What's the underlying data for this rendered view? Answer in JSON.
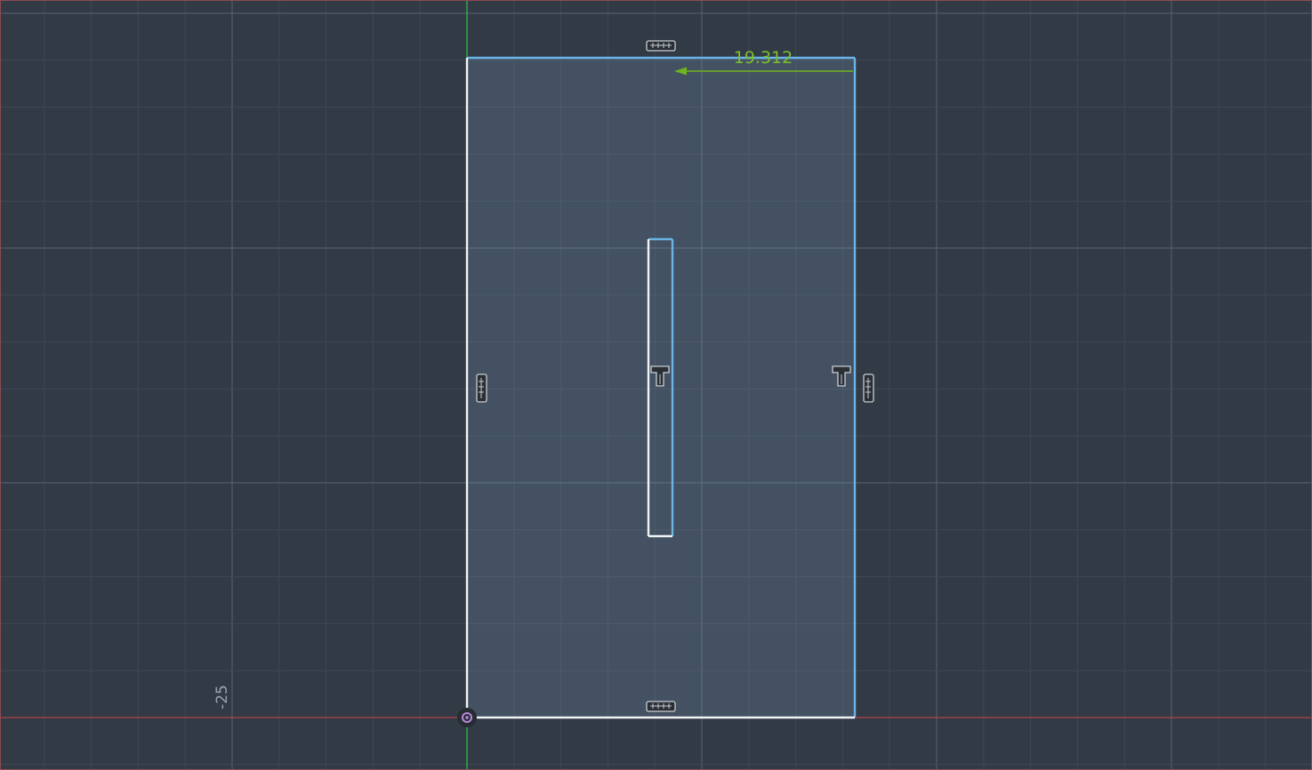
{
  "sketch": {
    "dimension_value": "19.312",
    "grid_label": "-25",
    "colors": {
      "background": "#323a46",
      "grid_minor": "#3f4753",
      "grid_major": "#535c69",
      "axis_vertical": "#34c24a",
      "axis_horizontal": "#b0444c",
      "profile_fill": "#7fa6c9",
      "edge_unconstrained": "#6ab4e6",
      "edge_constrained": "#f1f3f5",
      "dimension": "#7ec02a",
      "origin": "#b78ad9"
    },
    "constraint_icons": [
      "horizontal-constraint-icon",
      "vertical-constraint-icon",
      "perpendicular-constraint-icon"
    ]
  }
}
